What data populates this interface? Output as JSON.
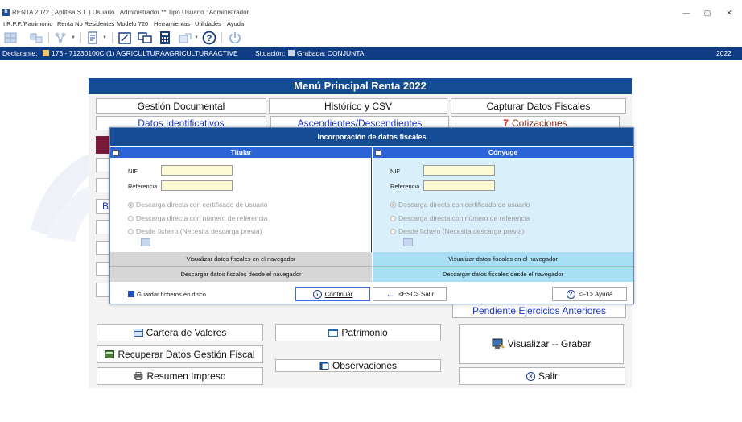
{
  "window": {
    "title": "RENTA 2022 ( Aplifisa S.L.) Usuario : Administrador  **  Tipo Usuario : Administrador",
    "app_icon": "R",
    "minimize": "—",
    "maximize": "▢",
    "close": "✕"
  },
  "menubar": [
    "I.R.P.F./Patrimonio",
    "Renta No Residentes",
    "Modelo 720",
    "Herramientas",
    "Utilidades",
    "Ayuda"
  ],
  "statusbar": {
    "declarante_label": "Declarante:",
    "declarante_value": "173 - 71230100C  (1)  AGRICULTURAAGRICULTURAACTIVE",
    "situacion_label": "Situación:",
    "situacion_value": "Grabada: CONJUNTA",
    "year": "2022"
  },
  "menu": {
    "title": "Menú Principal Renta 2022",
    "top_buttons": [
      "Gestión Documental",
      "Histórico y CSV",
      "Capturar Datos Fiscales"
    ],
    "row2": [
      "Datos Identificativos",
      "Ascendientes/Descendientes",
      "Cotizaciones"
    ],
    "partial_b": "B",
    "pendiente": "Pendiente Ejercicios Anteriores",
    "cartera": "Cartera de Valores",
    "patrimonio": "Patrimonio",
    "visualizar": "Visualizar -- Grabar",
    "recuperar": "Recuperar Datos Gestión Fiscal",
    "observaciones": "Observaciones",
    "resumen": "Resumen Impreso",
    "salir": "Salir"
  },
  "dialog": {
    "title": "Incorporación de datos fiscales",
    "titular": {
      "header": "Titular",
      "nif_label": "NIF",
      "nif_value": "",
      "ref_label": "Referencia",
      "ref_value": "",
      "opt1": "Descarga directa con certificado de usuario",
      "opt2": "Descarga directa con número de referencia",
      "opt3": "Desde fichero (Necesita descarga previa)",
      "btn_visualizar": "Visualizar datos fiscales en el navegador",
      "btn_descargar": "Descargar datos fiscales desde el navegador"
    },
    "conyuge": {
      "header": "Cónyuge",
      "nif_label": "NIF",
      "nif_value": "",
      "ref_label": "Referencia",
      "ref_value": "",
      "opt1": "Descarga directa con certificado de usuario",
      "opt2": "Descarga directa con número de referencia",
      "opt3": "Desde fichero (Necesita descarga previa)",
      "btn_visualizar": "Visualizar datos fiscales en el navegador",
      "btn_descargar": "Descargar datos fiscales desde el navegador"
    },
    "guardar": "Guardar ficheros en disco",
    "continuar": "Continuar",
    "salir": "<ESC> Salir",
    "ayuda": "<F1> Ayuda"
  },
  "colors": {
    "status_bg": "#0f3c85",
    "header_bg": "#144c96",
    "col_header_bg": "#2c63d6",
    "conyuge_bg": "#d9f0fb",
    "input_bg": "#fdfbd6"
  }
}
